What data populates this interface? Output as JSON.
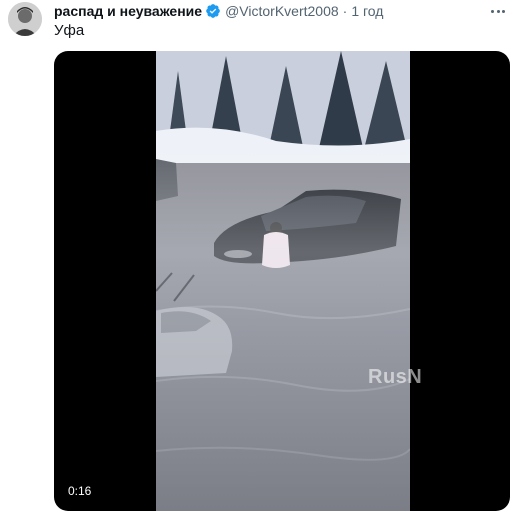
{
  "tweet": {
    "display_name": "распад и неуважение",
    "handle": "@VictorKvert2008",
    "separator": "·",
    "time": "1 год",
    "text": "Уфа",
    "verified_icon": "verified-badge-icon",
    "more_icon": "more-icon"
  },
  "video": {
    "duration": "0:16",
    "watermark": "RusN"
  },
  "colors": {
    "verified": "#1d9bf0",
    "muted_text": "#536471",
    "media_background": "#000000"
  }
}
